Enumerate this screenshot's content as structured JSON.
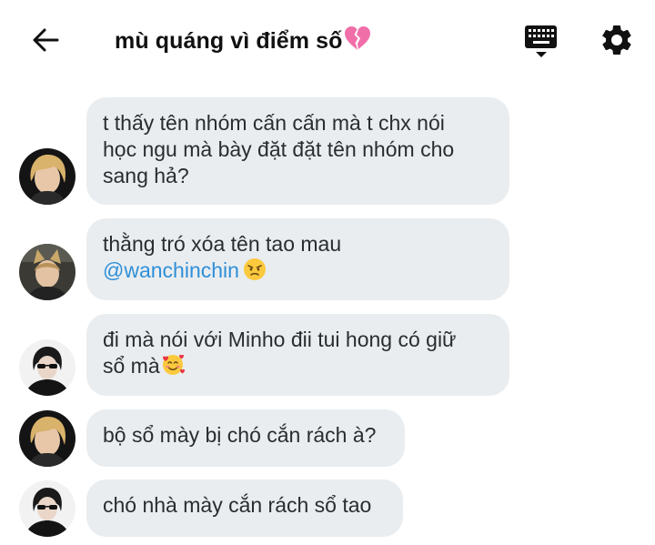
{
  "header": {
    "title": "mù quáng vì điểm số",
    "title_emoji": "broken-heart-emoji",
    "back_icon": "back-arrow-icon",
    "keyboard_icon": "keyboard-icon",
    "settings_icon": "gear-icon"
  },
  "messages": [
    {
      "avatar": "blonde-boy-avatar",
      "lines": [
        "t thấy tên nhóm cấn cấn mà t chx nói",
        "học ngu mà bày đặt đặt tên nhóm cho",
        "sang hả?"
      ]
    },
    {
      "avatar": "cat-ears-avatar",
      "line1": "thằng tró xóa tên tao mau",
      "mention": "@wanchinchin",
      "emoji": "angry-face-emoji"
    },
    {
      "avatar": "sunglasses-avatar",
      "line1": "đi mà nói với Minho đii tui hong có giữ",
      "line2": "sổ mà",
      "emoji": "smiling-face-with-hearts-emoji"
    },
    {
      "avatar": "blonde-boy-avatar",
      "text": "bộ sổ mày bị chó cắn rách à?"
    },
    {
      "avatar": "sunglasses-avatar",
      "text": "chó nhà mày cắn rách sổ tao"
    }
  ],
  "colors": {
    "bubble": "#e9edf0",
    "mention": "#2f8fd8",
    "text": "#2a2d30"
  }
}
